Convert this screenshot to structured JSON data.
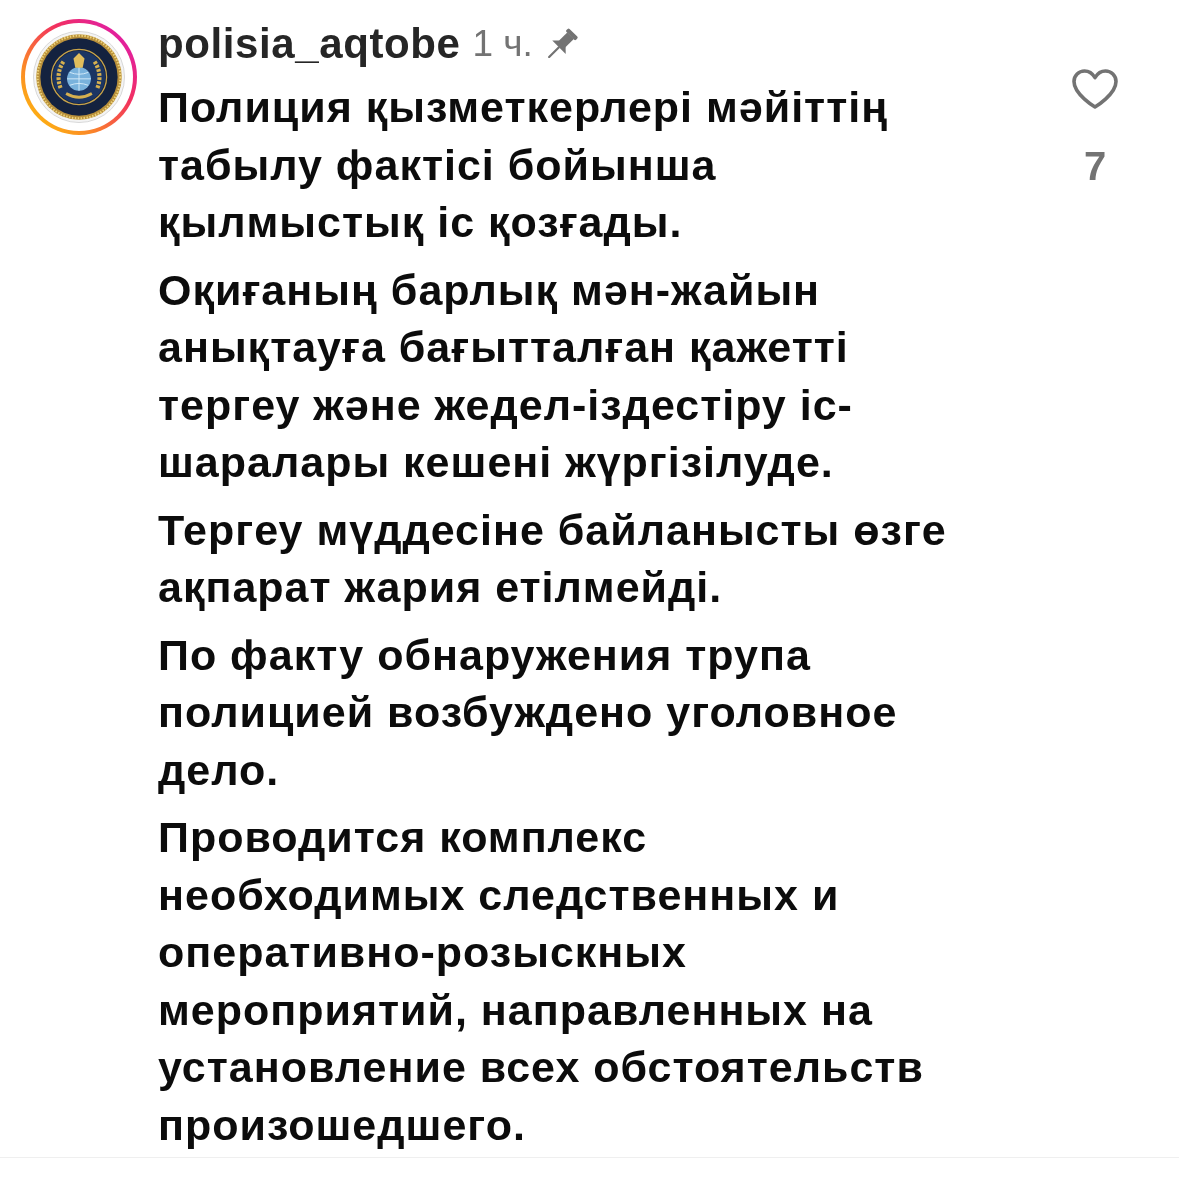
{
  "comment": {
    "author": {
      "username": "polisia_aqtobe",
      "has_story": true
    },
    "time": "1 ч.",
    "pinned": true,
    "paragraphs": [
      "Полиция қызметкерлері мәйіттің\nтабылу фактісі бойынша\nқылмыстық іс қозғады.",
      "Оқиғаның барлық мән-жайын\nанықтауға бағытталған қажетті\nтергеу және жедел-іздестіру іс-\nшаралары кешені жүргізілуде.",
      "Тергеу мүддесіне байланысты өзге\nақпарат жария етілмейді.",
      "По факту обнаружения трупа\nполицией возбуждено уголовное\nдело.",
      "Проводится комплекс\nнеобходимых следственных и\nоперативно-розыскных\nмероприятий, направленных на\nустановление всех обстоятельств\nпроизошедшего."
    ],
    "like": {
      "liked": false,
      "count": "7"
    }
  }
}
